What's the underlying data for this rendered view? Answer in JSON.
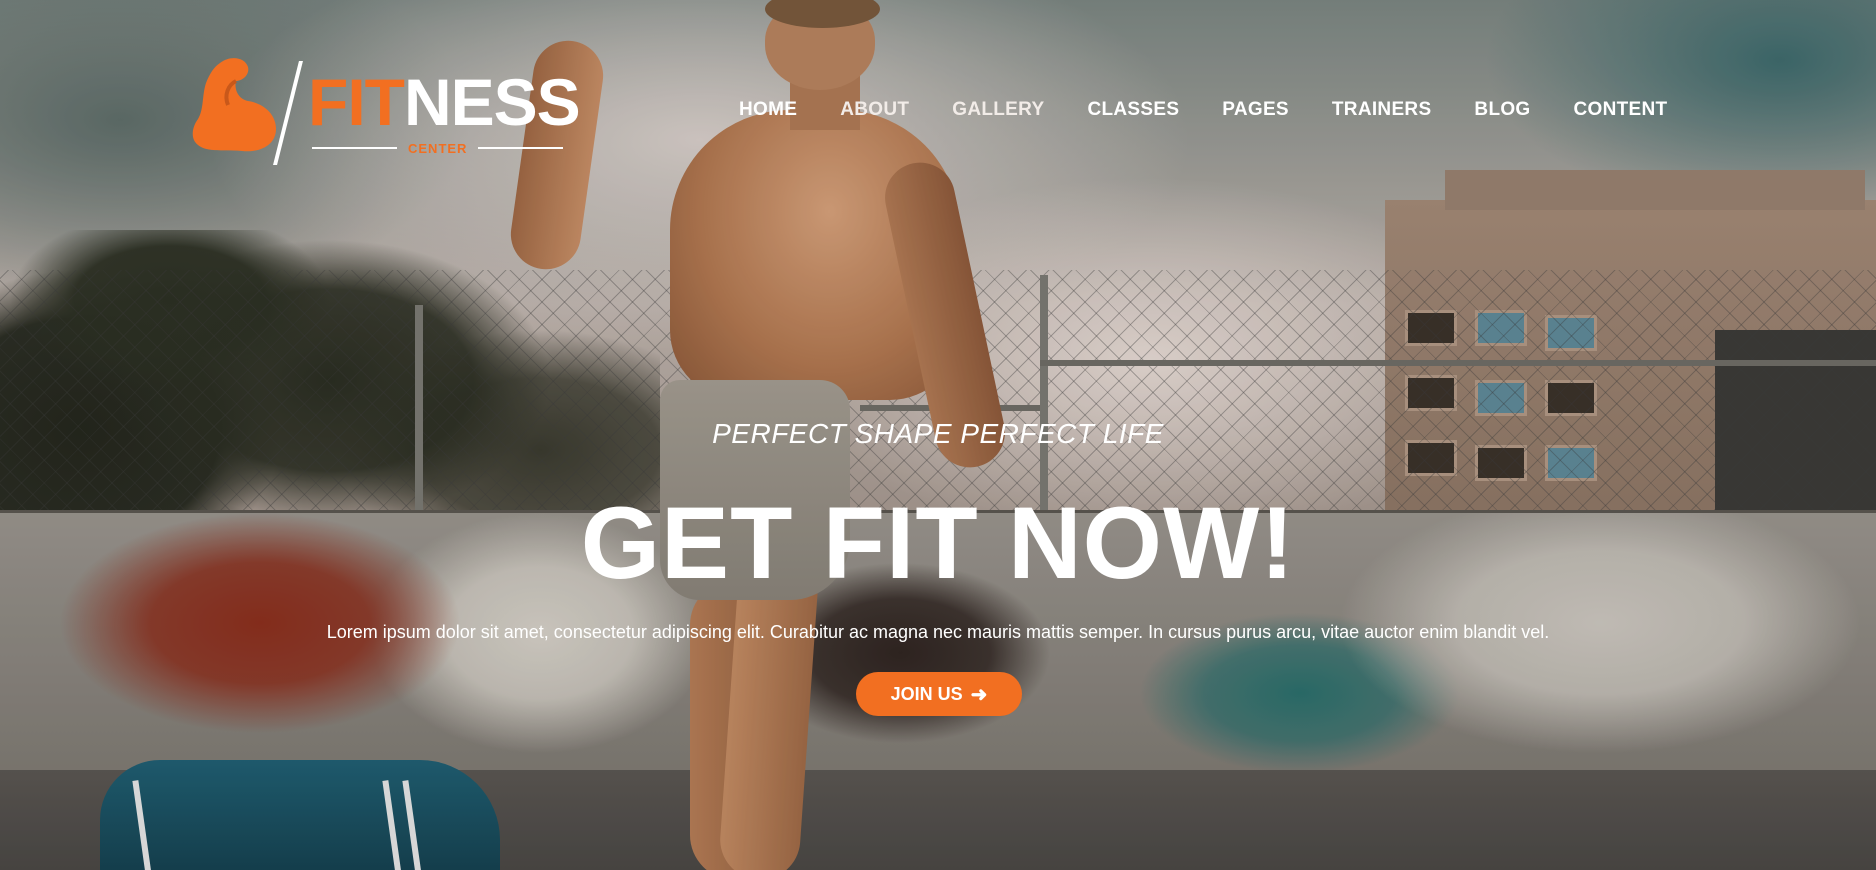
{
  "brand": {
    "logo_fit": "FIT",
    "logo_ness": "NESS",
    "logo_sub": "CENTER",
    "accent_color": "#f26f21"
  },
  "nav": {
    "items": [
      {
        "label": "HOME"
      },
      {
        "label": "ABOUT"
      },
      {
        "label": "GALLERY"
      },
      {
        "label": "CLASSES"
      },
      {
        "label": "PAGES"
      },
      {
        "label": "TRAINERS"
      },
      {
        "label": "BLOG"
      },
      {
        "label": "CONTENT"
      }
    ]
  },
  "hero": {
    "tagline": "PERFECT SHAPE PERFECT LIFE",
    "headline": "GET FIT NOW!",
    "description": "Lorem ipsum dolor sit amet, consectetur adipiscing elit. Curabitur ac magna nec mauris mattis semper. In cursus purus arcu, vitae auctor enim blandit vel.",
    "cta_label": "JOIN US",
    "cta_icon": "arrow-right-icon"
  }
}
